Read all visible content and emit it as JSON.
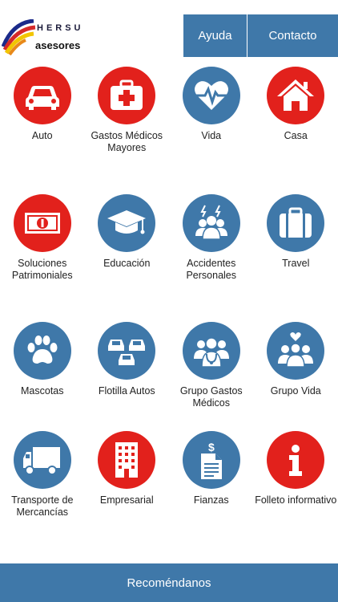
{
  "header": {
    "logo_top": "HERSU",
    "logo_bottom": "asesores",
    "nav": {
      "help_label": "Ayuda",
      "contact_label": "Contacto"
    }
  },
  "colors": {
    "accent_blue": "#3f78a9",
    "accent_red": "#e2211c"
  },
  "tiles": [
    {
      "label": "Auto",
      "icon": "car-icon",
      "color": "red"
    },
    {
      "label": "Gastos Médicos Mayores",
      "icon": "first-aid-kit-icon",
      "color": "red"
    },
    {
      "label": "Vida",
      "icon": "heart-pulse-icon",
      "color": "blue"
    },
    {
      "label": "Casa",
      "icon": "house-icon",
      "color": "red"
    },
    {
      "label": "Soluciones Patrimoniales",
      "icon": "banknote-icon",
      "color": "red"
    },
    {
      "label": "Educación",
      "icon": "graduation-cap-icon",
      "color": "blue"
    },
    {
      "label": "Accidentes Personales",
      "icon": "people-accident-icon",
      "color": "blue"
    },
    {
      "label": "Travel",
      "icon": "suitcase-icon",
      "color": "blue"
    },
    {
      "label": "Mascotas",
      "icon": "paw-icon",
      "color": "blue"
    },
    {
      "label": "Flotilla Autos",
      "icon": "car-fleet-icon",
      "color": "blue"
    },
    {
      "label": "Grupo Gastos Médicos",
      "icon": "group-doctor-icon",
      "color": "blue"
    },
    {
      "label": "Grupo Vida",
      "icon": "group-heart-icon",
      "color": "blue"
    },
    {
      "label": "Transporte de Mercancías",
      "icon": "truck-icon",
      "color": "blue"
    },
    {
      "label": "Empresarial",
      "icon": "building-icon",
      "color": "red"
    },
    {
      "label": "Fianzas",
      "icon": "document-dollar-icon",
      "color": "blue"
    },
    {
      "label": "Folleto informativo",
      "icon": "info-icon",
      "color": "red"
    }
  ],
  "footer": {
    "label": "Recoméndanos"
  }
}
